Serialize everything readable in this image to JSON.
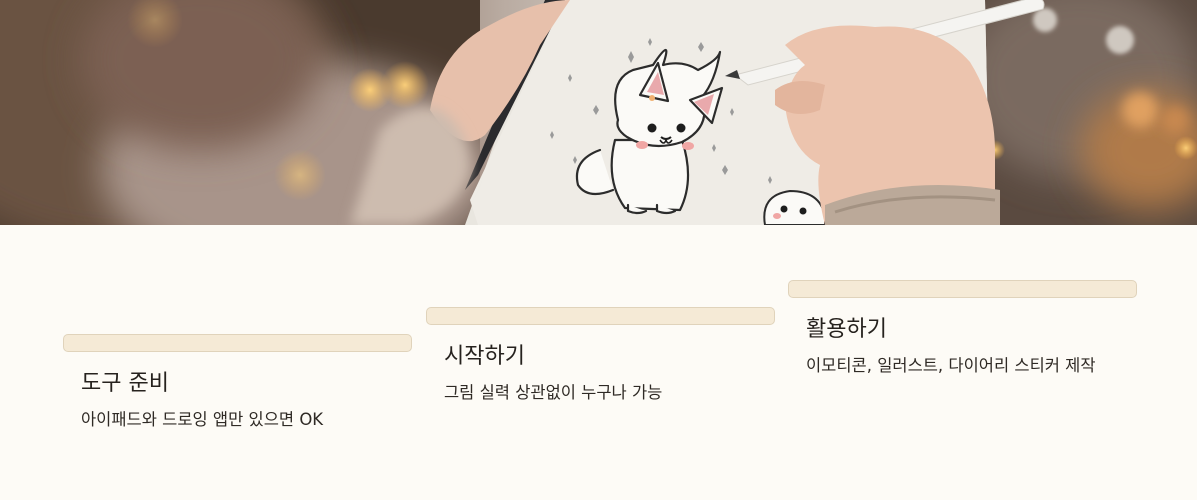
{
  "hero": {
    "alt": ""
  },
  "cards": [
    {
      "title": "도구 준비",
      "description": "아이패드와 드로잉 앱만 있으면 OK"
    },
    {
      "title": "시작하기",
      "description": "그림 실력 상관없이 누구나 가능"
    },
    {
      "title": "활용하기",
      "description": "이모티콘, 일러스트, 다이어리 스티커 제작"
    }
  ],
  "colors": {
    "background": "#fdfbf6",
    "card_bar": "#f5ead6",
    "card_bar_border": "#e0d3bb",
    "text": "#26221e"
  }
}
